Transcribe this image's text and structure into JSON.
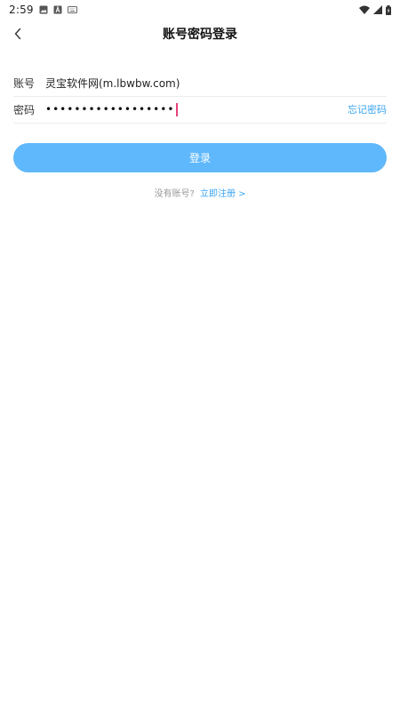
{
  "status_bar": {
    "time": "2:59",
    "icons": [
      "image-icon",
      "text-a-icon",
      "keyboard-icon",
      "wifi-icon",
      "signal-icon",
      "battery-icon"
    ]
  },
  "header": {
    "title": "账号密码登录",
    "back_icon": "chevron-left-icon"
  },
  "form": {
    "account_label": "账号",
    "account_value": "灵宝软件网(m.lbwbw.com)",
    "password_label": "密码",
    "password_masked": "••••••••••••••••••",
    "forgot_label": "忘记密码"
  },
  "login_button_label": "登录",
  "register": {
    "prompt": "没有账号?",
    "link": "立即注册 >"
  },
  "colors": {
    "accent": "#5fb8fb",
    "link": "#3aa5f0",
    "caret": "#e8407a"
  }
}
